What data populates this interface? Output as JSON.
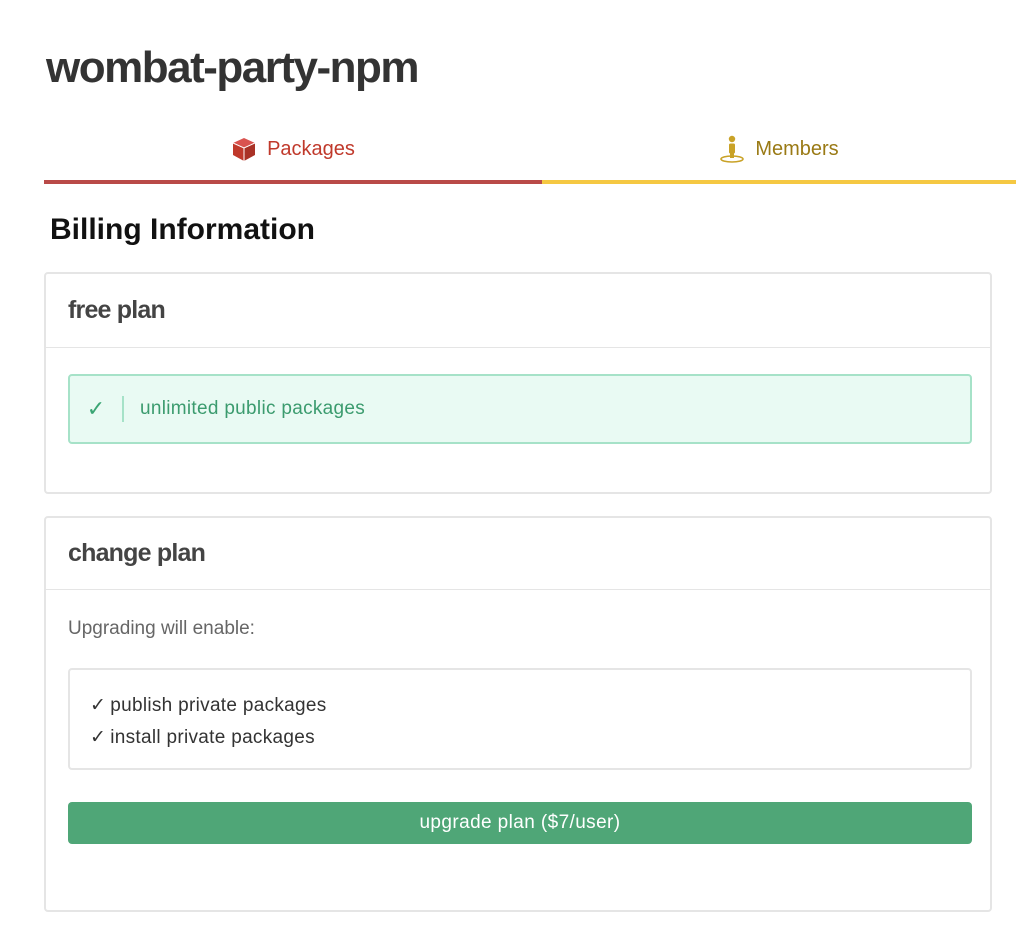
{
  "org": {
    "name": "wombat-party-npm"
  },
  "tabs": [
    {
      "label": "Packages",
      "icon": "package-box-icon",
      "color": "#c0392b",
      "underline_color": "#b94a48",
      "active": true
    },
    {
      "label": "Members",
      "icon": "person-icon",
      "color": "#9a7a15",
      "underline_color": "#f5c842",
      "active": false
    }
  ],
  "billing": {
    "title": "Billing Information",
    "current_plan": {
      "name": "free plan",
      "features": [
        {
          "check": "✓",
          "text": "unlimited public packages"
        }
      ]
    },
    "change_plan": {
      "title": "change plan",
      "intro": "Upgrading will enable:",
      "features": [
        {
          "check": "✓",
          "text": "publish private packages"
        },
        {
          "check": "✓",
          "text": "install private packages"
        }
      ],
      "button_label": "upgrade plan ($7/user)",
      "button_color": "#4fa677"
    }
  }
}
